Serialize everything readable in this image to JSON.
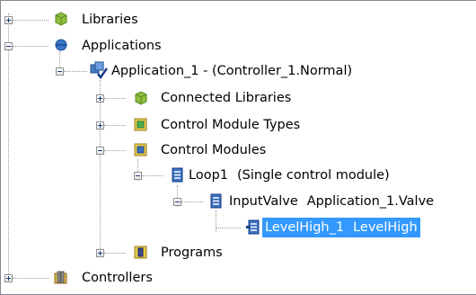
{
  "tree": {
    "libraries": {
      "label": "Libraries",
      "icon": "library-icon",
      "state": "collapsed"
    },
    "applications": {
      "label": "Applications",
      "icon": "applications-icon",
      "state": "expanded"
    },
    "application_1": {
      "label": "Application_1 - (Controller_1.Normal)",
      "icon": "application-icon",
      "state": "expanded"
    },
    "connected_libraries": {
      "label": "Connected Libraries",
      "icon": "library-icon",
      "state": "collapsed"
    },
    "control_module_types": {
      "label": "Control Module Types",
      "icon": "module-types-icon",
      "state": "collapsed"
    },
    "control_modules": {
      "label": "Control Modules",
      "icon": "module-folder-icon",
      "state": "expanded"
    },
    "loop1": {
      "label": "Loop1",
      "detail": "(Single control module)",
      "icon": "control-module-icon",
      "state": "expanded"
    },
    "inputvalve": {
      "label": "InputValve",
      "detail": "Application_1.Valve",
      "icon": "control-module-icon",
      "state": "expanded"
    },
    "levelhigh": {
      "label": "LevelHigh_1",
      "detail": "LevelHigh",
      "icon": "control-module-icon",
      "selected": true
    },
    "programs": {
      "label": "Programs",
      "icon": "programs-icon",
      "state": "collapsed"
    },
    "controllers": {
      "label": "Controllers",
      "icon": "controllers-icon",
      "state": "collapsed"
    }
  },
  "colors": {
    "selection": "#3399ff",
    "selection_text": "#ffffff",
    "tree_lines": "#9a9a9a"
  }
}
